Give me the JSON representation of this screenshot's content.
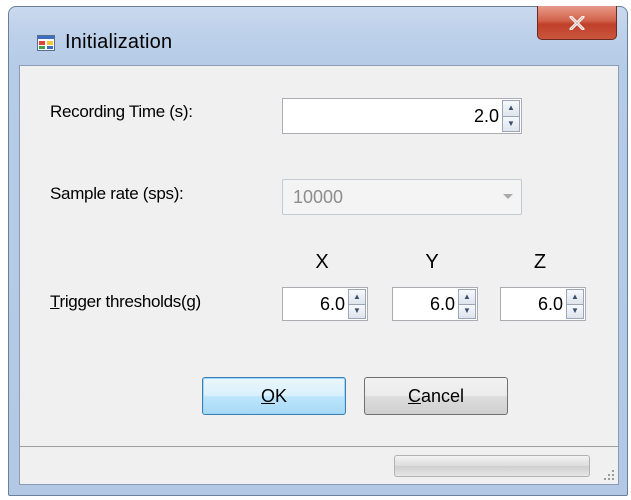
{
  "window": {
    "title": "Initialization",
    "app_icon": "window-app-icon",
    "close_icon": "close-x-icon"
  },
  "form": {
    "recording_time": {
      "label": "Recording Time (s):",
      "value": "2.0"
    },
    "sample_rate": {
      "label": "Sample rate (sps):",
      "value": "10000",
      "enabled": false
    },
    "trigger": {
      "label_mnemonic": "T",
      "label_rest": "rigger thresholds(g)",
      "axes": [
        {
          "name": "X",
          "value": "6.0"
        },
        {
          "name": "Y",
          "value": "6.0"
        },
        {
          "name": "Z",
          "value": "6.0"
        }
      ]
    }
  },
  "buttons": {
    "ok": {
      "mnemonic": "O",
      "rest": "K"
    },
    "cancel": {
      "mnemonic": "C",
      "rest": "ancel"
    }
  },
  "status": {
    "progress": 0
  },
  "colors": {
    "close_button": "#c9553d",
    "default_button_border": "#3c7fb1"
  }
}
